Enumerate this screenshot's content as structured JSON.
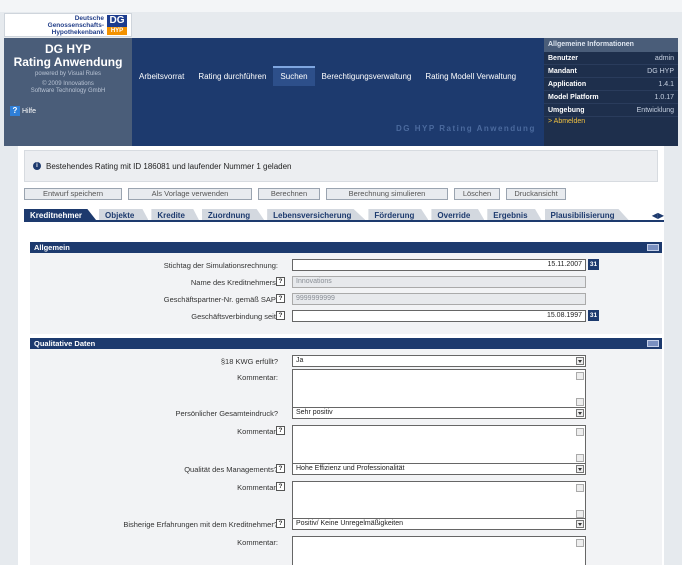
{
  "logo": {
    "line1": "Deutsche",
    "line2": "Genossenschafts-",
    "line3": "Hypothekenbank",
    "mark_top": "DG",
    "mark_bottom": "HYP"
  },
  "app": {
    "title_line1": "DG HYP",
    "title_line2": "Rating Anwendung",
    "powered": "powered by Visual Rules",
    "copyright_line1": "© 2009 Innovations",
    "copyright_line2": "Software Technology GmbH",
    "help": "Hilfe"
  },
  "nav": [
    "Arbeitsvorrat",
    "Rating durchführen",
    "Suchen",
    "Berechtigungsverwaltung",
    "Rating Modell Verwaltung"
  ],
  "nav_active": "Suchen",
  "watermark": "DG HYP Rating Anwendung",
  "info": {
    "title": "Allgemeine Informationen",
    "rows": [
      {
        "k": "Benutzer",
        "v": "admin"
      },
      {
        "k": "Mandant",
        "v": "DG HYP"
      },
      {
        "k": "Application",
        "v": "1.4.1"
      },
      {
        "k": "Model Platform",
        "v": "1.0.17"
      },
      {
        "k": "Umgebung",
        "v": "Entwicklung"
      }
    ],
    "logout": "> Abmelden"
  },
  "message": "Bestehendes Rating mit ID 186081 und laufender Nummer 1 geladen",
  "buttons": [
    "Entwurf speichern",
    "Als Vorlage verwenden",
    "Berechnen",
    "Berechnung simulieren",
    "Löschen",
    "Druckansicht"
  ],
  "tabs": [
    "Kreditnehmer",
    "Objekte",
    "Kredite",
    "Zuordnung",
    "Lebensversicherung",
    "Förderung",
    "Override",
    "Ergebnis",
    "Plausibilisierung"
  ],
  "tab_arrows": "◀▶",
  "allgemein": {
    "title": "Allgemein",
    "stichtag_label": "Stichtag der Simulationsrechnung:",
    "stichtag_value": "15.11.2007",
    "name_label": "Name des Kreditnehmers:",
    "name_value": "Innovations",
    "gp_label": "Geschäftspartner-Nr. gemäß SAP:",
    "gp_value": "9999999999",
    "gv_label": "Geschäftsverbindung seit:",
    "gv_value": "15.08.1997"
  },
  "qualitativ": {
    "title": "Qualitative Daten",
    "kwg_label": "§18 KWG erfüllt?",
    "kwg_value": "Ja",
    "kommentar": "Kommentar:",
    "gesamt_label": "Persönlicher Gesamteindruck?",
    "gesamt_value": "Sehr positiv",
    "mgmt_label": "Qualität des Managements?",
    "mgmt_value": "Hohe Effizienz und Professionalität",
    "erf_label": "Bisherige Erfahrungen mit dem Kreditnehmer?",
    "erf_value": "Positiv/ Keine Unregelmäßigkeiten"
  },
  "icons": {
    "help": "?",
    "calendar": "31",
    "qmark": "?",
    "info": "i"
  }
}
